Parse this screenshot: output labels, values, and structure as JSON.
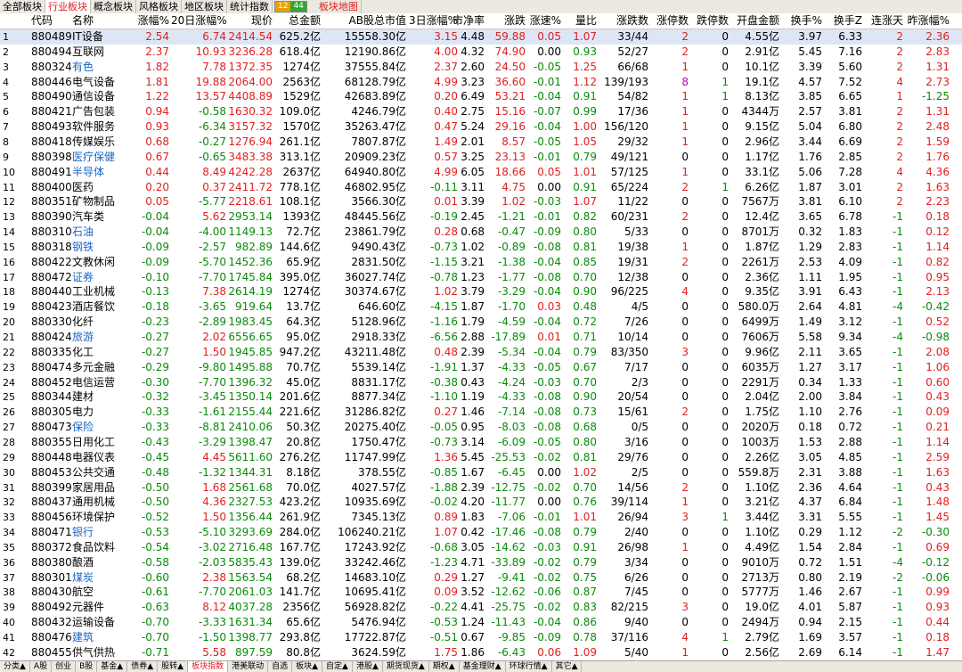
{
  "top_tabs": [
    {
      "label": "全部板块",
      "active": false
    },
    {
      "label": "行业板块",
      "active": true
    },
    {
      "label": "概念板块",
      "active": false
    },
    {
      "label": "风格板块",
      "active": false
    },
    {
      "label": "地区板块",
      "active": false
    },
    {
      "label": "统计指数",
      "active": false
    }
  ],
  "up_count": "12",
  "down_count": "44",
  "map_label": "板块地图",
  "columns": [
    {
      "key": "no",
      "label": ""
    },
    {
      "key": "code",
      "label": "代码"
    },
    {
      "key": "name",
      "label": "名称"
    },
    {
      "key": "chg",
      "label": "涨幅%"
    },
    {
      "key": "chg20",
      "label": "20日涨幅%"
    },
    {
      "key": "price",
      "label": "现价"
    },
    {
      "key": "amt",
      "label": "总金额"
    },
    {
      "key": "mcap",
      "label": "AB股总市值"
    },
    {
      "key": "chg3",
      "label": "3日涨幅%"
    },
    {
      "key": "pb",
      "label": "市净率"
    },
    {
      "key": "diff",
      "label": "涨跌"
    },
    {
      "key": "speed",
      "label": "涨速%"
    },
    {
      "key": "vr",
      "label": "量比"
    },
    {
      "key": "ud",
      "label": "涨跌数"
    },
    {
      "key": "lu",
      "label": "涨停数"
    },
    {
      "key": "ld",
      "label": "跌停数"
    },
    {
      "key": "open_amt",
      "label": "开盘金额"
    },
    {
      "key": "turn",
      "label": "换手%"
    },
    {
      "key": "turnz",
      "label": "换手Z"
    },
    {
      "key": "streak",
      "label": "连涨天"
    },
    {
      "key": "ychg",
      "label": "昨涨幅%"
    }
  ],
  "rows": [
    [
      "1",
      "880489",
      "IT设备",
      "2.54",
      "6.74",
      "2414.54",
      "625.2亿",
      "15558.30亿",
      "3.15",
      "4.48",
      "59.88",
      "0.05",
      "1.07",
      "33/44",
      "2",
      "0",
      "4.55亿",
      "3.97",
      "6.33",
      "2",
      "2.36"
    ],
    [
      "2",
      "880494",
      "互联网",
      "2.37",
      "10.93",
      "3236.28",
      "618.4亿",
      "12190.86亿",
      "4.00",
      "4.32",
      "74.90",
      "0.00",
      "0.93",
      "52/27",
      "2",
      "0",
      "2.91亿",
      "5.45",
      "7.16",
      "2",
      "2.83"
    ],
    [
      "3",
      "880324",
      "有色",
      "1.82",
      "7.78",
      "1372.35",
      "1274亿",
      "37555.84亿",
      "2.37",
      "2.60",
      "24.50",
      "-0.05",
      "1.25",
      "66/68",
      "1",
      "0",
      "10.1亿",
      "3.39",
      "5.60",
      "2",
      "1.31"
    ],
    [
      "4",
      "880446",
      "电气设备",
      "1.81",
      "19.88",
      "2064.00",
      "2563亿",
      "68128.79亿",
      "4.99",
      "3.23",
      "36.60",
      "-0.01",
      "1.12",
      "139/193",
      "8",
      "1",
      "19.1亿",
      "4.57",
      "7.52",
      "4",
      "2.73"
    ],
    [
      "5",
      "880490",
      "通信设备",
      "1.22",
      "13.57",
      "4408.89",
      "1529亿",
      "42683.89亿",
      "0.20",
      "6.49",
      "53.21",
      "-0.04",
      "0.91",
      "54/82",
      "1",
      "1",
      "8.13亿",
      "3.85",
      "6.65",
      "1",
      "-1.25"
    ],
    [
      "6",
      "880421",
      "广告包装",
      "0.94",
      "-0.58",
      "1630.32",
      "109.0亿",
      "4246.79亿",
      "0.40",
      "2.75",
      "15.16",
      "-0.07",
      "0.99",
      "17/36",
      "1",
      "0",
      "4344万",
      "2.57",
      "3.81",
      "2",
      "1.31"
    ],
    [
      "7",
      "880493",
      "软件服务",
      "0.93",
      "-6.34",
      "3157.32",
      "1570亿",
      "35263.47亿",
      "0.47",
      "5.24",
      "29.16",
      "-0.04",
      "1.00",
      "156/120",
      "1",
      "0",
      "9.15亿",
      "5.04",
      "6.80",
      "2",
      "2.48"
    ],
    [
      "8",
      "880418",
      "传媒娱乐",
      "0.68",
      "-0.27",
      "1276.94",
      "261.1亿",
      "7807.87亿",
      "1.49",
      "2.01",
      "8.57",
      "-0.05",
      "1.05",
      "29/32",
      "1",
      "0",
      "2.96亿",
      "3.44",
      "6.69",
      "2",
      "1.59"
    ],
    [
      "9",
      "880398",
      "医疗保健",
      "0.67",
      "-0.65",
      "3483.38",
      "313.1亿",
      "20909.23亿",
      "0.57",
      "3.25",
      "23.13",
      "-0.01",
      "0.79",
      "49/121",
      "0",
      "0",
      "1.17亿",
      "1.76",
      "2.85",
      "2",
      "1.76"
    ],
    [
      "10",
      "880491",
      "半导体",
      "0.44",
      "8.49",
      "4242.28",
      "2637亿",
      "64940.80亿",
      "4.99",
      "6.05",
      "18.66",
      "0.05",
      "1.01",
      "57/125",
      "1",
      "0",
      "33.1亿",
      "5.06",
      "7.28",
      "4",
      "4.36"
    ],
    [
      "11",
      "880400",
      "医药",
      "0.20",
      "0.37",
      "2411.72",
      "778.1亿",
      "46802.95亿",
      "-0.11",
      "3.11",
      "4.75",
      "0.00",
      "0.91",
      "65/224",
      "2",
      "1",
      "6.26亿",
      "1.87",
      "3.01",
      "2",
      "1.63"
    ],
    [
      "12",
      "880351",
      "矿物制品",
      "0.05",
      "-5.77",
      "2218.61",
      "108.1亿",
      "3566.30亿",
      "0.01",
      "3.39",
      "1.02",
      "-0.03",
      "1.07",
      "11/22",
      "0",
      "0",
      "7567万",
      "3.81",
      "6.10",
      "2",
      "2.23"
    ],
    [
      "13",
      "880390",
      "汽车类",
      "-0.04",
      "5.62",
      "2953.14",
      "1393亿",
      "48445.56亿",
      "-0.19",
      "2.45",
      "-1.21",
      "-0.01",
      "0.82",
      "60/231",
      "2",
      "0",
      "12.4亿",
      "3.65",
      "6.78",
      "-1",
      "0.18"
    ],
    [
      "14",
      "880310",
      "石油",
      "-0.04",
      "-4.00",
      "1149.13",
      "72.7亿",
      "23861.79亿",
      "0.28",
      "0.68",
      "-0.47",
      "-0.09",
      "0.80",
      "5/33",
      "0",
      "0",
      "8701万",
      "0.32",
      "1.83",
      "-1",
      "0.12"
    ],
    [
      "15",
      "880318",
      "钢铁",
      "-0.09",
      "-2.57",
      "982.89",
      "144.6亿",
      "9490.43亿",
      "-0.73",
      "1.02",
      "-0.89",
      "-0.08",
      "0.81",
      "19/38",
      "1",
      "0",
      "1.87亿",
      "1.29",
      "2.83",
      "-1",
      "1.14"
    ],
    [
      "16",
      "880422",
      "文教休闲",
      "-0.09",
      "-5.70",
      "1452.36",
      "65.9亿",
      "2831.50亿",
      "-1.15",
      "3.21",
      "-1.38",
      "-0.04",
      "0.85",
      "19/31",
      "2",
      "0",
      "2261万",
      "2.53",
      "4.09",
      "-1",
      "0.82"
    ],
    [
      "17",
      "880472",
      "证券",
      "-0.10",
      "-7.70",
      "1745.84",
      "395.0亿",
      "36027.74亿",
      "-0.78",
      "1.23",
      "-1.77",
      "-0.08",
      "0.70",
      "12/38",
      "0",
      "0",
      "2.36亿",
      "1.11",
      "1.95",
      "-1",
      "0.95"
    ],
    [
      "18",
      "880440",
      "工业机械",
      "-0.13",
      "7.38",
      "2614.19",
      "1274亿",
      "30374.67亿",
      "1.02",
      "3.79",
      "-3.29",
      "-0.04",
      "0.90",
      "96/225",
      "4",
      "0",
      "9.35亿",
      "3.91",
      "6.43",
      "-1",
      "2.13"
    ],
    [
      "19",
      "880423",
      "酒店餐饮",
      "-0.18",
      "-3.65",
      "919.64",
      "13.7亿",
      "646.60亿",
      "-4.15",
      "1.87",
      "-1.70",
      "0.03",
      "0.48",
      "4/5",
      "0",
      "0",
      "580.0万",
      "2.64",
      "4.81",
      "-4",
      "-0.42"
    ],
    [
      "20",
      "880330",
      "化纤",
      "-0.23",
      "-2.89",
      "1983.45",
      "64.3亿",
      "5128.96亿",
      "-1.16",
      "1.79",
      "-4.59",
      "-0.04",
      "0.72",
      "7/26",
      "0",
      "0",
      "6499万",
      "1.49",
      "3.12",
      "-1",
      "0.52"
    ],
    [
      "21",
      "880424",
      "旅游",
      "-0.27",
      "2.02",
      "6556.65",
      "95.0亿",
      "2918.33亿",
      "-6.56",
      "2.88",
      "-17.89",
      "0.01",
      "0.71",
      "10/14",
      "0",
      "0",
      "7606万",
      "5.58",
      "9.34",
      "-4",
      "-0.98"
    ],
    [
      "22",
      "880335",
      "化工",
      "-0.27",
      "1.50",
      "1945.85",
      "947.2亿",
      "43211.48亿",
      "0.48",
      "2.39",
      "-5.34",
      "-0.04",
      "0.79",
      "83/350",
      "3",
      "0",
      "9.96亿",
      "2.11",
      "3.65",
      "-1",
      "2.08"
    ],
    [
      "23",
      "880474",
      "多元金融",
      "-0.29",
      "-9.80",
      "1495.88",
      "70.7亿",
      "5539.14亿",
      "-1.91",
      "1.37",
      "-4.33",
      "-0.05",
      "0.67",
      "7/17",
      "0",
      "0",
      "6035万",
      "1.27",
      "3.17",
      "-1",
      "1.06"
    ],
    [
      "24",
      "880452",
      "电信运营",
      "-0.30",
      "-7.70",
      "1396.32",
      "45.0亿",
      "8831.17亿",
      "-0.38",
      "0.43",
      "-4.24",
      "-0.03",
      "0.70",
      "2/3",
      "0",
      "0",
      "2291万",
      "0.34",
      "1.33",
      "-1",
      "0.60"
    ],
    [
      "25",
      "880344",
      "建材",
      "-0.32",
      "-3.45",
      "1350.14",
      "201.6亿",
      "8877.34亿",
      "-1.10",
      "1.19",
      "-4.33",
      "-0.08",
      "0.90",
      "20/54",
      "0",
      "0",
      "2.04亿",
      "2.00",
      "3.84",
      "-1",
      "0.43"
    ],
    [
      "26",
      "880305",
      "电力",
      "-0.33",
      "-1.61",
      "2155.44",
      "221.6亿",
      "31286.82亿",
      "0.27",
      "1.46",
      "-7.14",
      "-0.08",
      "0.73",
      "15/61",
      "2",
      "0",
      "1.75亿",
      "1.10",
      "2.76",
      "-1",
      "0.09"
    ],
    [
      "27",
      "880473",
      "保险",
      "-0.33",
      "-8.81",
      "2410.06",
      "50.3亿",
      "20275.40亿",
      "-0.05",
      "0.95",
      "-8.03",
      "-0.08",
      "0.68",
      "0/5",
      "0",
      "0",
      "2020万",
      "0.18",
      "0.72",
      "-1",
      "0.21"
    ],
    [
      "28",
      "880355",
      "日用化工",
      "-0.43",
      "-3.29",
      "1398.47",
      "20.8亿",
      "1750.47亿",
      "-0.73",
      "3.14",
      "-6.09",
      "-0.05",
      "0.80",
      "3/16",
      "0",
      "0",
      "1003万",
      "1.53",
      "2.88",
      "-1",
      "1.14"
    ],
    [
      "29",
      "880448",
      "电器仪表",
      "-0.45",
      "4.45",
      "5611.60",
      "276.2亿",
      "11747.99亿",
      "1.36",
      "5.45",
      "-25.53",
      "-0.02",
      "0.81",
      "29/76",
      "0",
      "0",
      "2.26亿",
      "3.05",
      "4.85",
      "-1",
      "2.59"
    ],
    [
      "30",
      "880453",
      "公共交通",
      "-0.48",
      "-1.32",
      "1344.31",
      "8.18亿",
      "378.55亿",
      "-0.85",
      "1.67",
      "-6.45",
      "0.00",
      "1.02",
      "2/5",
      "0",
      "0",
      "559.8万",
      "2.31",
      "3.88",
      "-1",
      "1.63"
    ],
    [
      "31",
      "880399",
      "家居用品",
      "-0.50",
      "1.68",
      "2561.68",
      "70.0亿",
      "4027.57亿",
      "-1.88",
      "2.39",
      "-12.75",
      "-0.02",
      "0.70",
      "14/56",
      "2",
      "0",
      "1.10亿",
      "2.36",
      "4.64",
      "-1",
      "0.43"
    ],
    [
      "32",
      "880437",
      "通用机械",
      "-0.50",
      "4.36",
      "2327.53",
      "423.2亿",
      "10935.69亿",
      "-0.02",
      "4.20",
      "-11.77",
      "0.00",
      "0.76",
      "39/114",
      "1",
      "0",
      "3.21亿",
      "4.37",
      "6.84",
      "-1",
      "1.48"
    ],
    [
      "33",
      "880456",
      "环境保护",
      "-0.52",
      "1.50",
      "1356.44",
      "261.9亿",
      "7345.13亿",
      "0.89",
      "1.83",
      "-7.06",
      "-0.01",
      "1.01",
      "26/94",
      "3",
      "1",
      "3.44亿",
      "3.31",
      "5.55",
      "-1",
      "1.45"
    ],
    [
      "34",
      "880471",
      "银行",
      "-0.53",
      "-5.10",
      "3293.69",
      "284.0亿",
      "106240.21亿",
      "1.07",
      "0.42",
      "-17.46",
      "-0.08",
      "0.79",
      "2/40",
      "0",
      "0",
      "1.10亿",
      "0.29",
      "1.12",
      "-2",
      "-0.30"
    ],
    [
      "35",
      "880372",
      "食品饮料",
      "-0.54",
      "-3.02",
      "2716.48",
      "167.7亿",
      "17243.92亿",
      "-0.68",
      "3.05",
      "-14.62",
      "-0.03",
      "0.91",
      "26/98",
      "1",
      "0",
      "4.49亿",
      "1.54",
      "2.84",
      "-1",
      "0.69"
    ],
    [
      "36",
      "880380",
      "酿酒",
      "-0.58",
      "-2.03",
      "5835.43",
      "139.0亿",
      "33242.46亿",
      "-1.23",
      "4.71",
      "-33.89",
      "-0.02",
      "0.79",
      "3/34",
      "0",
      "0",
      "9010万",
      "0.72",
      "1.51",
      "-4",
      "-0.12"
    ],
    [
      "37",
      "880301",
      "煤炭",
      "-0.60",
      "2.38",
      "1563.54",
      "68.2亿",
      "14683.10亿",
      "0.29",
      "1.27",
      "-9.41",
      "-0.02",
      "0.75",
      "6/26",
      "0",
      "0",
      "2713万",
      "0.80",
      "2.19",
      "-2",
      "-0.06"
    ],
    [
      "38",
      "880430",
      "航空",
      "-0.61",
      "-7.70",
      "2061.03",
      "141.7亿",
      "10695.41亿",
      "0.09",
      "3.52",
      "-12.62",
      "-0.06",
      "0.87",
      "7/45",
      "0",
      "0",
      "5777万",
      "1.46",
      "2.67",
      "-1",
      "0.99"
    ],
    [
      "39",
      "880492",
      "元器件",
      "-0.63",
      "8.12",
      "4037.28",
      "2356亿",
      "56928.82亿",
      "-0.22",
      "4.41",
      "-25.75",
      "-0.02",
      "0.83",
      "82/215",
      "3",
      "0",
      "19.0亿",
      "4.01",
      "5.87",
      "-1",
      "0.93"
    ],
    [
      "40",
      "880432",
      "运输设备",
      "-0.70",
      "-3.33",
      "1631.34",
      "65.6亿",
      "5476.94亿",
      "-0.53",
      "1.24",
      "-11.43",
      "-0.04",
      "0.86",
      "9/40",
      "0",
      "0",
      "2494万",
      "0.94",
      "2.15",
      "-1",
      "0.44"
    ],
    [
      "41",
      "880476",
      "建筑",
      "-0.70",
      "-1.50",
      "1398.77",
      "293.8亿",
      "17722.87亿",
      "-0.51",
      "0.67",
      "-9.85",
      "-0.09",
      "0.78",
      "37/116",
      "4",
      "1",
      "2.79亿",
      "1.69",
      "3.57",
      "-1",
      "0.18"
    ],
    [
      "42",
      "880455",
      "供气供热",
      "-0.71",
      "5.58",
      "897.59",
      "80.8亿",
      "3624.59亿",
      "1.75",
      "1.86",
      "-6.43",
      "0.06",
      "1.09",
      "5/40",
      "1",
      "0",
      "2.56亿",
      "2.69",
      "6.14",
      "-1",
      "1.47"
    ]
  ],
  "blue_names": [
    "有色",
    "医疗保健",
    "半导体",
    "石油",
    "钢铁",
    "证券",
    "旅游",
    "保险",
    "银行",
    "煤炭",
    "建筑"
  ],
  "bottom_tabs": [
    {
      "label": "分类▲",
      "active": false
    },
    {
      "label": "A股",
      "active": false
    },
    {
      "label": "创业",
      "active": false
    },
    {
      "label": "B股",
      "active": false
    },
    {
      "label": "基金▲",
      "active": false
    },
    {
      "label": "债券▲",
      "active": false
    },
    {
      "label": "股转▲",
      "active": false
    },
    {
      "label": "板块指数",
      "active": true
    },
    {
      "label": "港美联动",
      "active": false
    },
    {
      "label": "自选",
      "active": false
    },
    {
      "label": "板块▲",
      "active": false
    },
    {
      "label": "自定▲",
      "active": false
    },
    {
      "label": "港股▲",
      "active": false
    },
    {
      "label": "期货现货▲",
      "active": false
    },
    {
      "label": "期权▲",
      "active": false
    },
    {
      "label": "基金理财▲",
      "active": false
    },
    {
      "label": "环球行情▲",
      "active": false
    },
    {
      "label": "其它▲",
      "active": false
    }
  ]
}
